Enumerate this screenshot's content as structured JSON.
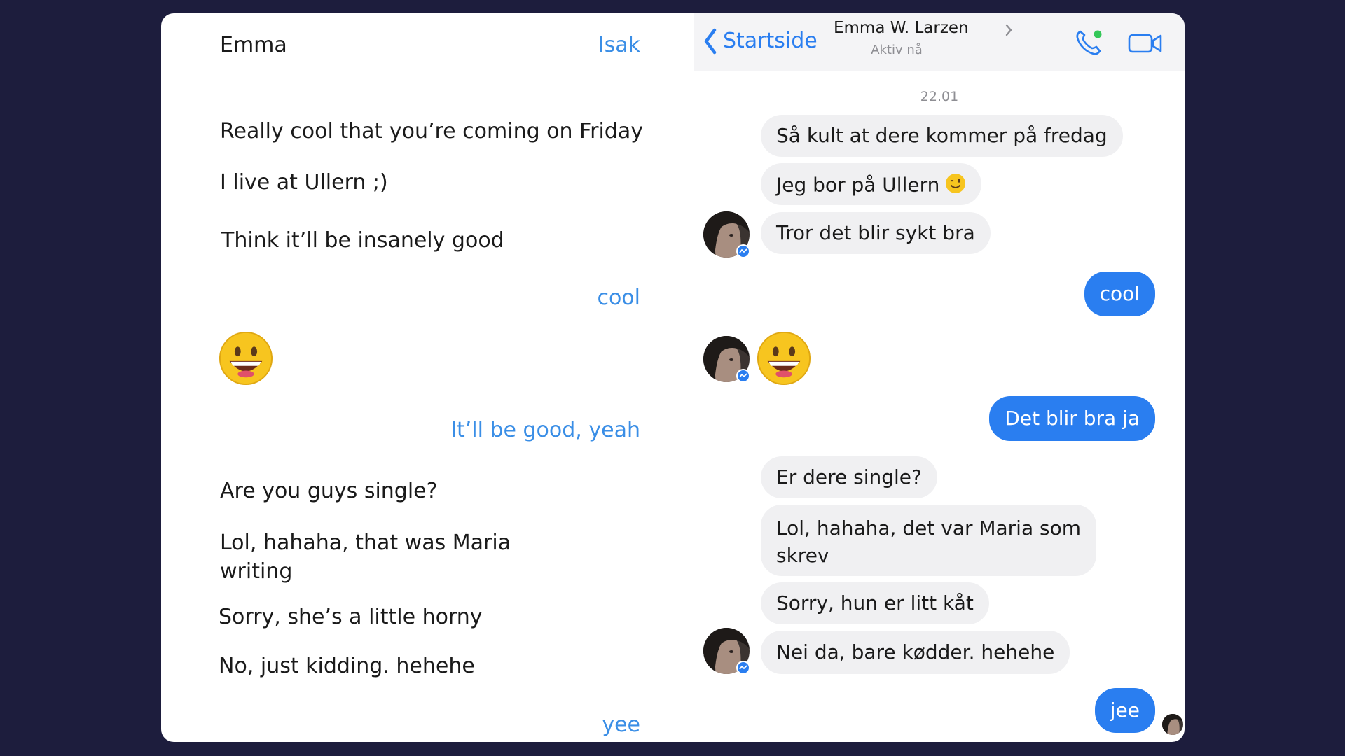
{
  "translation": {
    "header_left": "Emma",
    "header_right": "Isak",
    "lines": [
      {
        "text": "Really cool that you’re coming on Friday",
        "from": "emma"
      },
      {
        "text": "I live at Ullern ;)",
        "from": "emma"
      },
      {
        "text": "Think it’ll be insanely good",
        "from": "emma"
      },
      {
        "text": "cool",
        "from": "isak"
      },
      {
        "text": "It’ll be good, yeah",
        "from": "isak"
      },
      {
        "text": "Are you guys single?",
        "from": "emma"
      },
      {
        "text": "Lol, hahaha, that was Maria",
        "from": "emma"
      },
      {
        "text": "writing",
        "from": "emma"
      },
      {
        "text": "Sorry, she’s a little horny",
        "from": "emma"
      },
      {
        "text": "No, just kidding. hehehe",
        "from": "emma"
      },
      {
        "text": "yee",
        "from": "isak"
      }
    ]
  },
  "messenger": {
    "back_label": "Startside",
    "contact_name": "Emma W. Larzen",
    "contact_status": "Aktiv nå",
    "date": "22.01",
    "messages": [
      {
        "text": "Så kult at dere kommer på fredag",
        "from": "them"
      },
      {
        "text": "Jeg bor på Ullern",
        "from": "them",
        "emoji": "wink-emoji"
      },
      {
        "text": "Tror det blir sykt bra",
        "from": "them"
      },
      {
        "text": "cool",
        "from": "me"
      },
      {
        "text": "Det blir bra ja",
        "from": "me"
      },
      {
        "text": "Er dere single?",
        "from": "them"
      },
      {
        "text": "Lol, hahaha, det var Maria som",
        "from": "them"
      },
      {
        "text": "skrev",
        "from": "them"
      },
      {
        "text": "Sorry, hun er litt kåt",
        "from": "them"
      },
      {
        "text": "Nei da, bare kødder. hehehe",
        "from": "them"
      },
      {
        "text": "jee",
        "from": "me"
      }
    ],
    "accent_color": "#2a7ef0",
    "online_color": "#34c759"
  },
  "icons": [
    "back-chevron-icon",
    "phone-icon",
    "video-icon",
    "messenger-badge-icon",
    "smiley-emoji",
    "wink-emoji"
  ]
}
